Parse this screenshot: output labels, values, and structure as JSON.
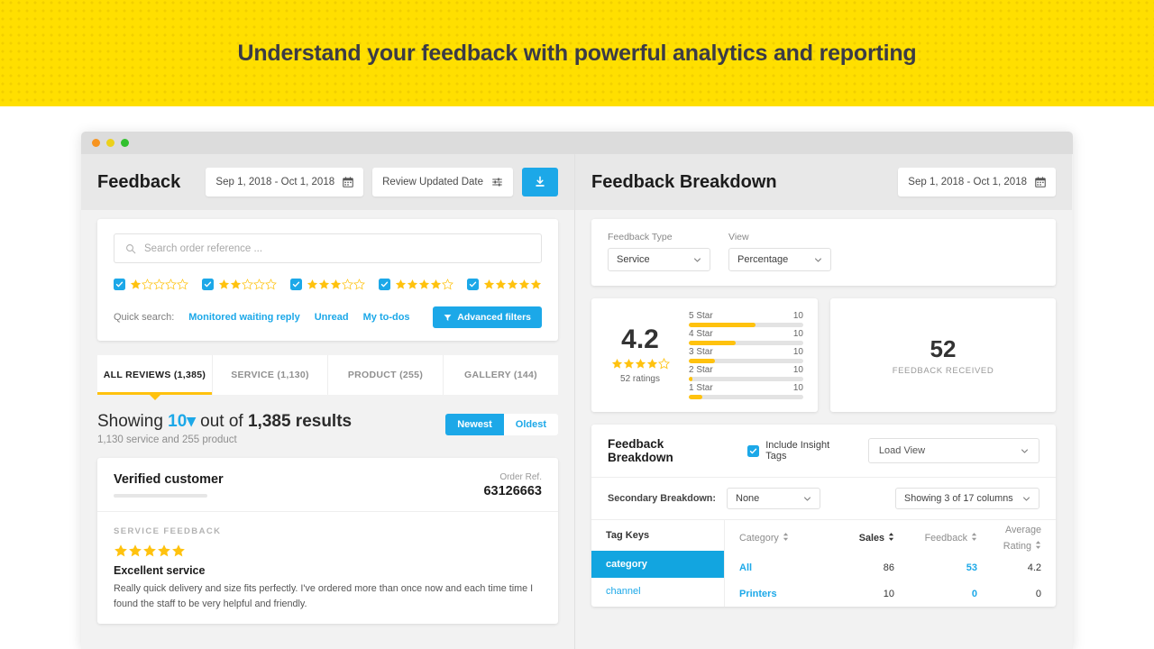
{
  "banner": {
    "title": "Understand your feedback with powerful analytics and reporting"
  },
  "window": {
    "dots": [
      "close",
      "minimize",
      "maximize"
    ]
  },
  "left": {
    "title": "Feedback",
    "date_range": "Sep 1, 2018 - Oct 1, 2018",
    "date_mode": "Review Updated Date",
    "export_icon": "download-icon",
    "search_placeholder": "Search order reference ...",
    "search_value": "",
    "star_filters": [
      {
        "stars": 1,
        "checked": true
      },
      {
        "stars": 2,
        "checked": true
      },
      {
        "stars": 3,
        "checked": true
      },
      {
        "stars": 4,
        "checked": true
      },
      {
        "stars": 5,
        "checked": true
      }
    ],
    "quick_search_label": "Quick search:",
    "quick_links": [
      "Monitored waiting reply",
      "Unread",
      "My to-dos"
    ],
    "advanced_filters": "Advanced filters",
    "tabs": [
      {
        "label": "ALL REVIEWS (1,385)",
        "active": true
      },
      {
        "label": "SERVICE (1,130)",
        "active": false
      },
      {
        "label": "PRODUCT (255)",
        "active": false
      },
      {
        "label": "GALLERY (144)",
        "active": false
      }
    ],
    "showing_prefix": "Showing",
    "showing_count": "10",
    "showing_mid": "out of",
    "showing_total": "1,385 results",
    "showing_sub": "1,130 service and 255 product",
    "sort_newest": "Newest",
    "sort_oldest": "Oldest",
    "review": {
      "name": "Verified customer",
      "order_label": "Order Ref.",
      "order_number": "63126663",
      "feedback_type": "SERVICE FEEDBACK",
      "rating": 5,
      "title": "Excellent service",
      "text": "Really quick delivery and size fits perfectly. I've ordered more than once now and each time time I found the staff to be very helpful and friendly."
    }
  },
  "right": {
    "title": "Feedback Breakdown",
    "date_range": "Sep 1, 2018 - Oct 1, 2018",
    "controls": {
      "feedback_type_label": "Feedback Type",
      "feedback_type_value": "Service",
      "view_label": "View",
      "view_value": "Percentage"
    },
    "feedback_received_num": "52",
    "feedback_received_label": "FEEDBACK RECEIVED",
    "breakdown": {
      "title": "Feedback Breakdown",
      "include_insight_tags": "Include Insight Tags",
      "include_insight_checked": true,
      "load_view": "Load View",
      "secondary_label": "Secondary Breakdown:",
      "secondary_value": "None",
      "columns_showing": "Showing 3 of 17 columns",
      "tag_keys_header": "Tag Keys",
      "tag_keys": [
        {
          "label": "category",
          "selected": true
        },
        {
          "label": "channel",
          "selected": false
        }
      ],
      "table_headers": [
        "Category",
        "Sales",
        "Feedback",
        "Average Rating"
      ],
      "table_rows": [
        {
          "category": "All",
          "sales": "86",
          "feedback": "53",
          "avg": "4.2"
        },
        {
          "category": "Printers",
          "sales": "10",
          "feedback": "0",
          "avg": "0"
        }
      ]
    }
  },
  "chart_data": {
    "type": "bar",
    "title": "Rating distribution",
    "orientation": "horizontal",
    "average": "4.2",
    "average_stars": 4,
    "ratings_count_label": "52 ratings",
    "ratings_count": 52,
    "categories": [
      "5 Star",
      "4 Star",
      "3 Star",
      "2 Star",
      "1 Star"
    ],
    "values": [
      10,
      10,
      10,
      10,
      10
    ],
    "bar_percent": [
      58,
      41,
      23,
      3,
      12
    ],
    "xlabel": "",
    "ylabel": "",
    "grid": false,
    "legend": "none",
    "bar_color": "#FFC20E",
    "track_color": "#E3E3E3"
  },
  "colors": {
    "banner_yellow": "#FFDF00",
    "accent_blue": "#1CA8E8",
    "star_yellow": "#FFC20E",
    "text_dark": "#1C1C1C"
  }
}
